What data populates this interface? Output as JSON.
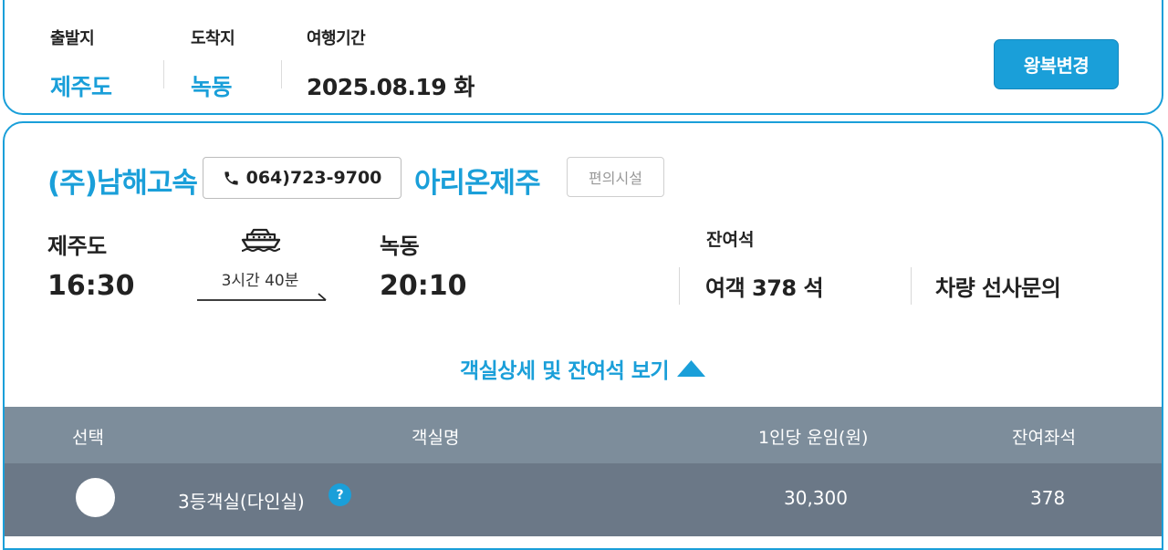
{
  "search": {
    "departure_label": "출발지",
    "departure_value": "제주도",
    "arrival_label": "도착지",
    "arrival_value": "녹동",
    "period_label": "여행기간",
    "period_value": "2025.08.19 화",
    "round_trip_button": "왕복변경"
  },
  "ferry": {
    "company": "(주)남해고속",
    "phone": "064)723-9700",
    "ship_name": "아리온제주",
    "facility_button": "편의시설",
    "departure_port": "제주도",
    "departure_time": "16:30",
    "arrival_port": "녹동",
    "arrival_time": "20:10",
    "duration": "3시간 40분",
    "remaining_label": "잔여석",
    "passenger_seats": "여객 378 석",
    "vehicle_seats": "차량 선사문의",
    "detail_toggle": "객실상세 및 잔여석 보기"
  },
  "cabin_table": {
    "headers": [
      "선택",
      "객실명",
      "1인당 운임(원)",
      "잔여좌석"
    ],
    "rows": [
      {
        "name": "3등객실(다인실)",
        "help": "?",
        "fare": "30,300",
        "remaining": "378"
      }
    ]
  },
  "colors": {
    "accent": "#1a9fd9",
    "table_header": "#7d8d9b",
    "table_row": "#6b7887"
  },
  "icons": [
    "phone-icon",
    "ship-icon",
    "route-arrow-icon",
    "triangle-up-icon",
    "help-icon"
  ]
}
